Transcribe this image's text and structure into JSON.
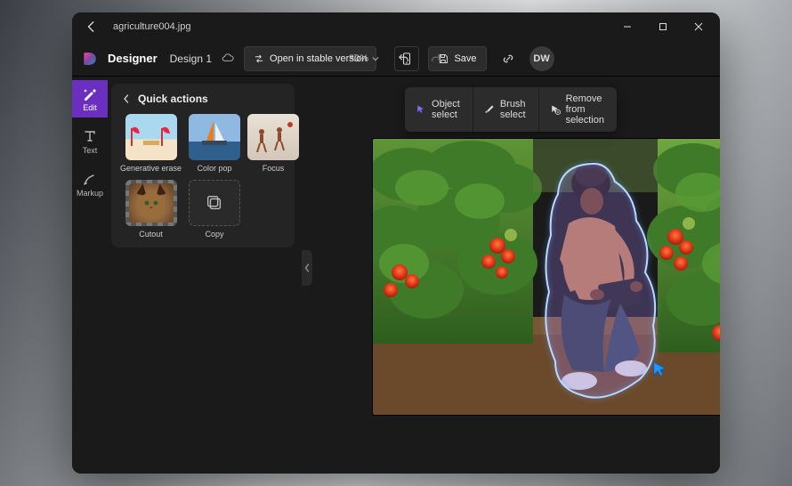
{
  "titlebar": {
    "filename": "agriculture004.jpg"
  },
  "app": {
    "name": "Designer",
    "design_name": "Design 1",
    "open_stable_label": "Open in stable version",
    "zoom": "30%",
    "save_label": "Save",
    "avatar_initials": "DW"
  },
  "rail": {
    "edit": "Edit",
    "text": "Text",
    "markup": "Markup"
  },
  "panel": {
    "title": "Quick actions",
    "tiles": {
      "gen_erase": "Generative erase",
      "color_pop": "Color pop",
      "focus": "Focus",
      "cutout": "Cutout",
      "copy": "Copy"
    }
  },
  "sel_toolbar": {
    "object_select": "Object select",
    "brush_select": "Brush select",
    "remove_sel": "Remove from selection"
  }
}
